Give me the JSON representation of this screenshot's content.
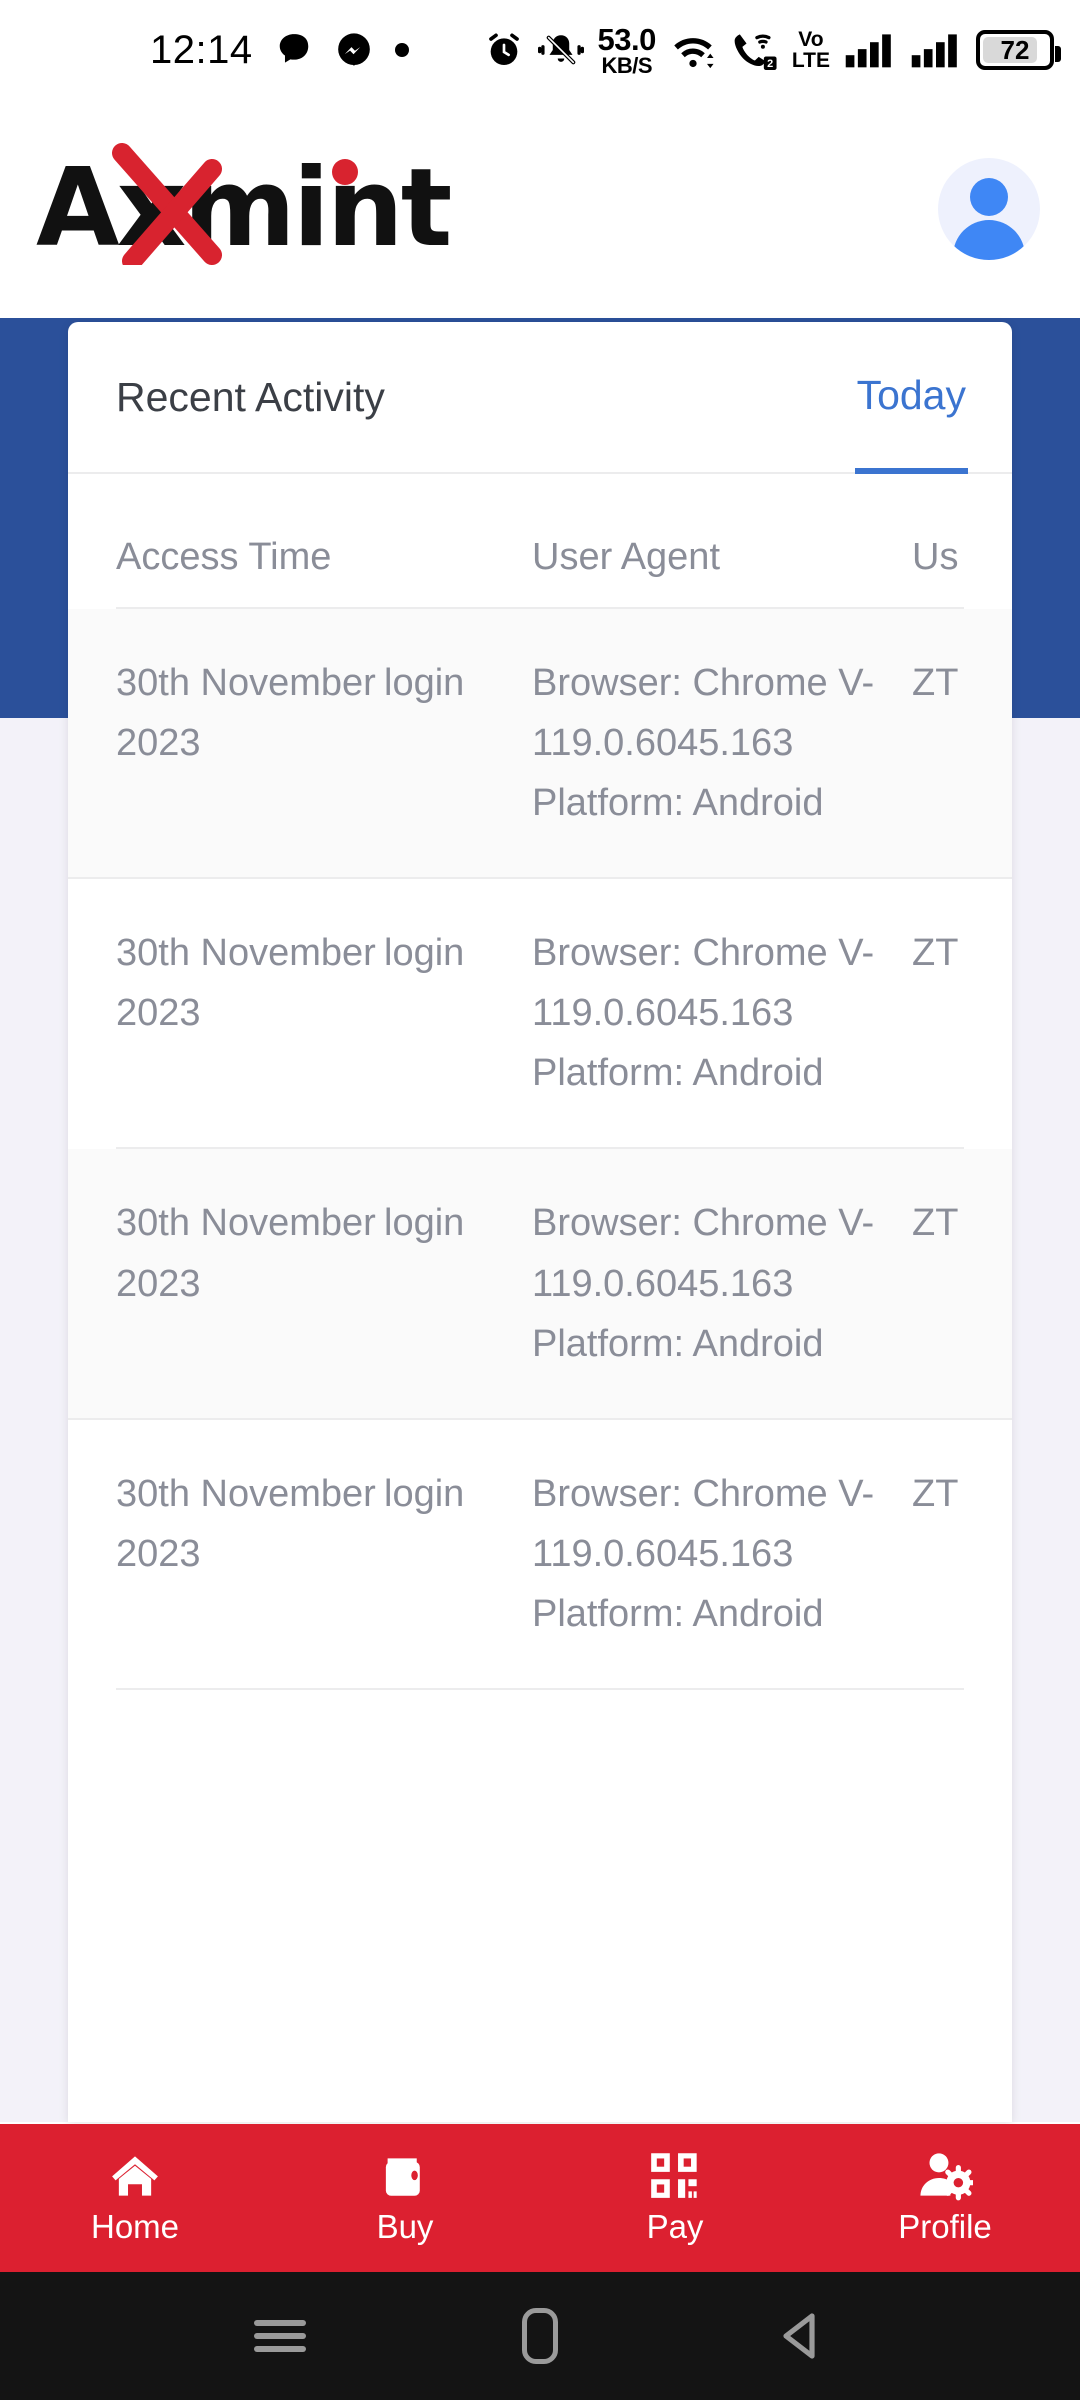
{
  "statusbar": {
    "time": "12:14",
    "left_icons": [
      "chat-bubble-icon",
      "messenger-icon",
      "dot-icon"
    ],
    "network_speed_value": "53.0",
    "network_speed_unit": "KB/S",
    "volte_line1": "Vo",
    "volte_line2": "LTE",
    "sim_badge": "2",
    "battery_percent": "72",
    "right_icons": [
      "alarm-icon",
      "bell-muted-icon",
      "wifi-icon",
      "wifi-calling-icon",
      "volte-icon",
      "signal-icon",
      "signal-icon",
      "battery-icon"
    ]
  },
  "appbar": {
    "logo_text": "Axmint",
    "logo_accent_color": "#d8232f",
    "avatar_icon": "user-avatar-icon"
  },
  "card": {
    "title": "Recent Activity",
    "tab_label": "Today",
    "accent_color": "#3b74d0",
    "table": {
      "columns": [
        "Access Time",
        "",
        "User Agent",
        "Us"
      ],
      "rows": [
        {
          "time": "30th November 2023",
          "action": "login",
          "agent": "Browser: Chrome V-119.0.6045.163 Platform: Android",
          "user": "ZT"
        },
        {
          "time": "30th November 2023",
          "action": "login",
          "agent": "Browser: Chrome V-119.0.6045.163 Platform: Android",
          "user": "ZT"
        },
        {
          "time": "30th November 2023",
          "action": "login",
          "agent": "Browser: Chrome V-119.0.6045.163 Platform: Android",
          "user": "ZT"
        },
        {
          "time": "30th November 2023",
          "action": "login",
          "agent": "Browser: Chrome V-119.0.6045.163 Platform: Android",
          "user": "ZT"
        }
      ]
    }
  },
  "bottomnav": {
    "background_color": "#DC2030",
    "items": [
      {
        "label": "Home",
        "icon": "home-icon"
      },
      {
        "label": "Buy",
        "icon": "wallet-icon"
      },
      {
        "label": "Pay",
        "icon": "qr-code-icon"
      },
      {
        "label": "Profile",
        "icon": "user-gear-icon"
      }
    ]
  },
  "androidnav": {
    "items": [
      "recents-icon",
      "home-icon",
      "back-icon"
    ]
  },
  "theme": {
    "blue_band": "#2B509A",
    "page_bg": "#F3F2F9",
    "text_muted": "#8a8d98"
  }
}
